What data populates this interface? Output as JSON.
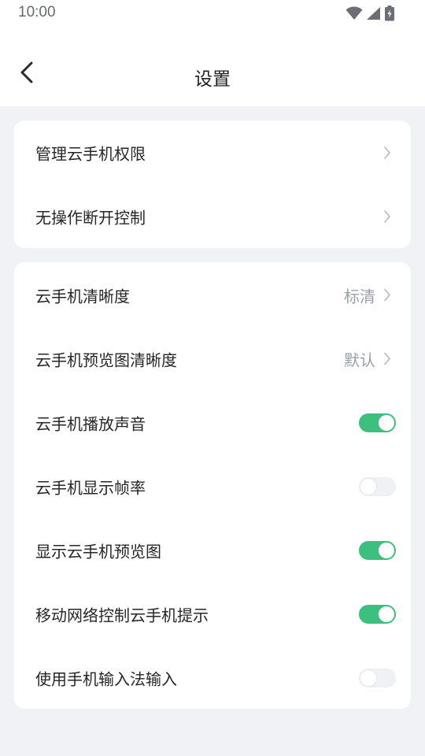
{
  "status_bar": {
    "time": "10:00",
    "icons": [
      "wifi-icon",
      "cellular-signal-icon",
      "battery-charging-icon"
    ]
  },
  "header": {
    "title": "设置",
    "back_icon": "chevron-left-icon"
  },
  "colors": {
    "toggle_on": "#3dbf7d",
    "toggle_off": "#f0f1f4",
    "background": "#f1f2f6"
  },
  "group_1": {
    "rows": [
      {
        "label": "管理云手机权限",
        "type": "link"
      },
      {
        "label": "无操作断开控制",
        "type": "link"
      }
    ]
  },
  "group_2": {
    "rows": [
      {
        "label": "云手机清晰度",
        "type": "select",
        "value": "标清"
      },
      {
        "label": "云手机预览图清晰度",
        "type": "select",
        "value": "默认"
      },
      {
        "label": "云手机播放声音",
        "type": "toggle",
        "on": true
      },
      {
        "label": "云手机显示帧率",
        "type": "toggle",
        "on": false
      },
      {
        "label": "显示云手机预览图",
        "type": "toggle",
        "on": true
      },
      {
        "label": "移动网络控制云手机提示",
        "type": "toggle",
        "on": true
      },
      {
        "label": "使用手机输入法输入",
        "type": "toggle",
        "on": false
      }
    ]
  }
}
